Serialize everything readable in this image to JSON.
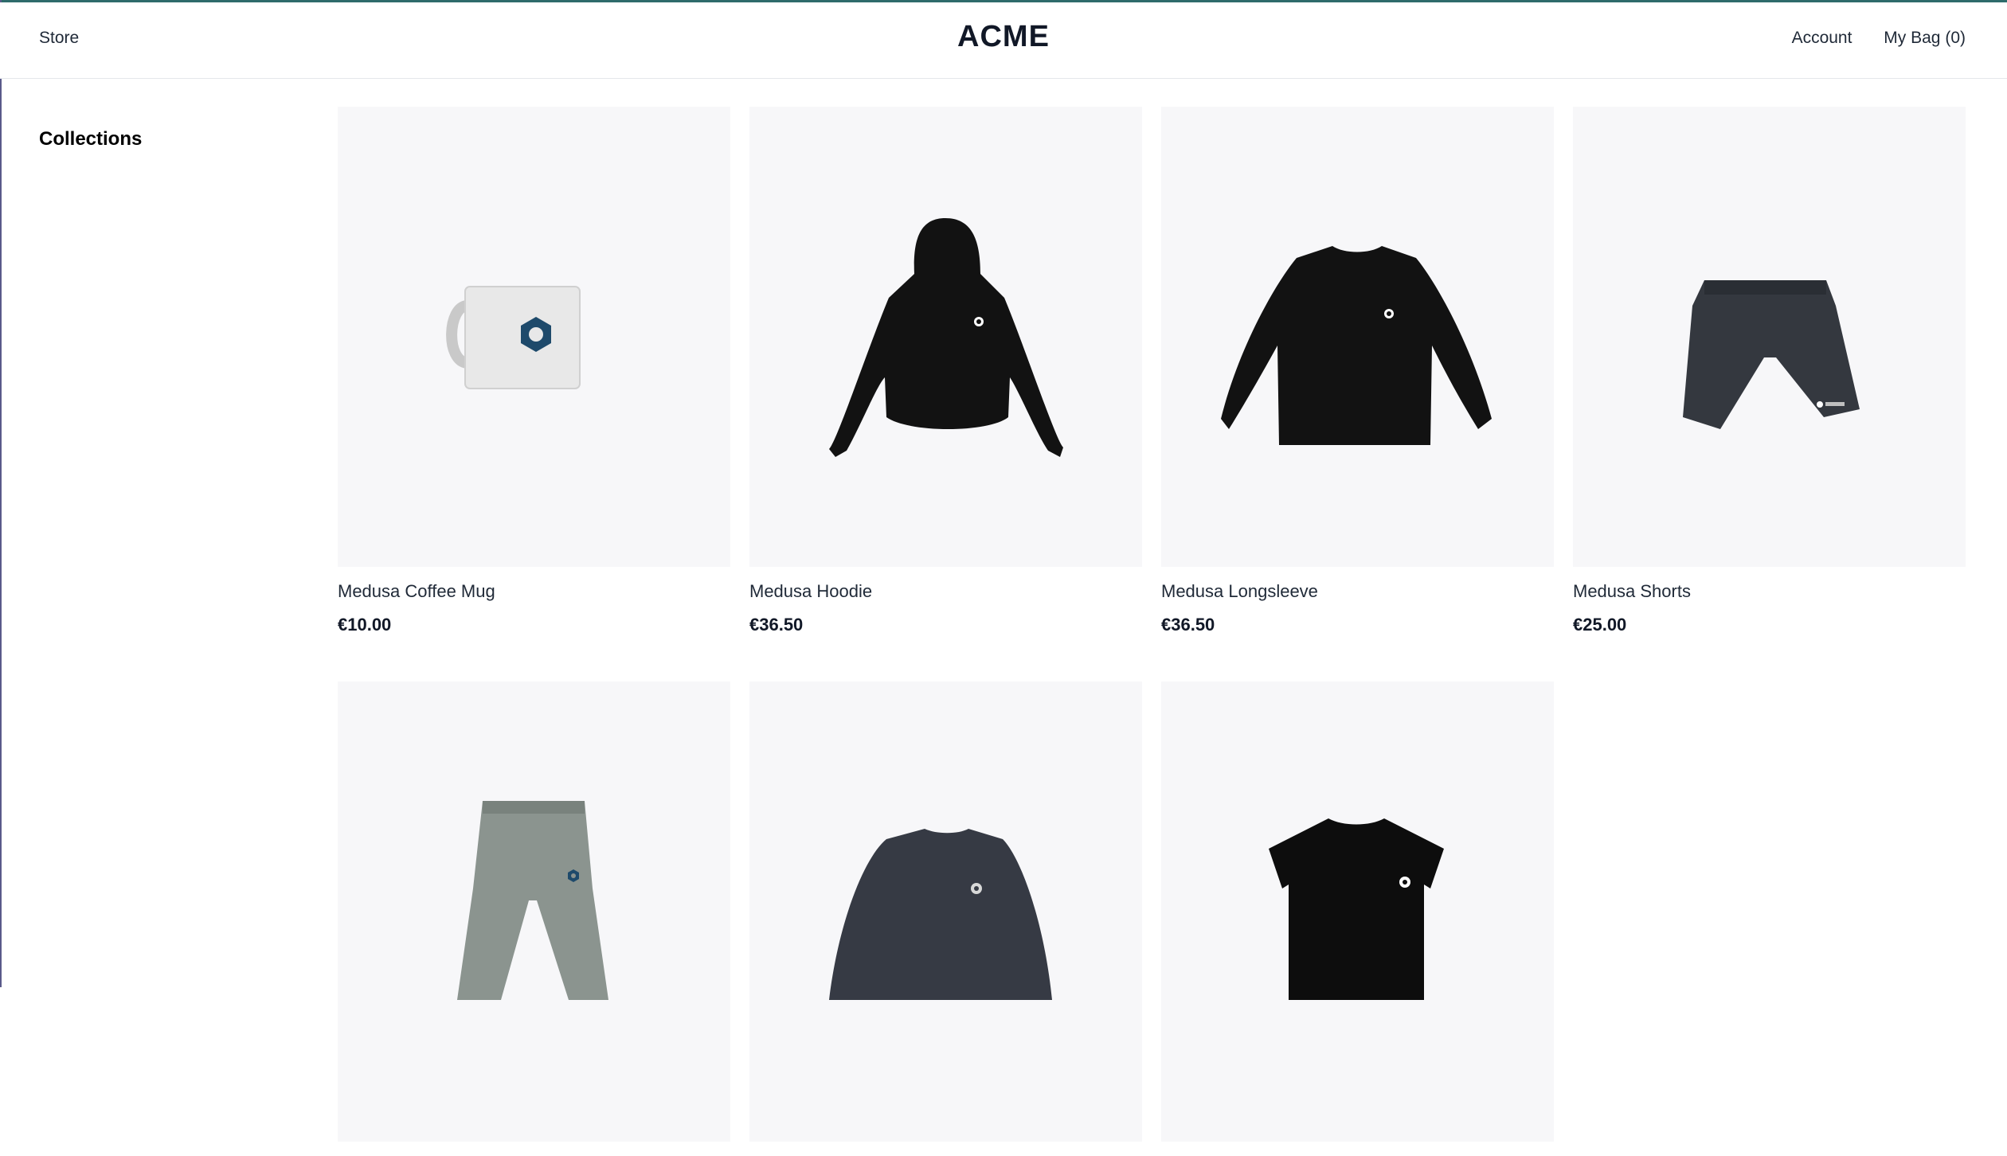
{
  "header": {
    "store_label": "Store",
    "logo": "ACME",
    "account_label": "Account",
    "bag_label": "My Bag (0)"
  },
  "sidebar": {
    "title": "Collections"
  },
  "products": [
    {
      "name": "Medusa Coffee Mug",
      "price": "€10.00",
      "icon": "mug-image"
    },
    {
      "name": "Medusa Hoodie",
      "price": "€36.50",
      "icon": "hoodie-image"
    },
    {
      "name": "Medusa Longsleeve",
      "price": "€36.50",
      "icon": "longsleeve-image"
    },
    {
      "name": "Medusa Shorts",
      "price": "€25.00",
      "icon": "shorts-image"
    },
    {
      "name": "",
      "price": "",
      "icon": "sweatpants-image"
    },
    {
      "name": "",
      "price": "",
      "icon": "sweatshirt-image"
    },
    {
      "name": "",
      "price": "",
      "icon": "tshirt-image"
    }
  ]
}
